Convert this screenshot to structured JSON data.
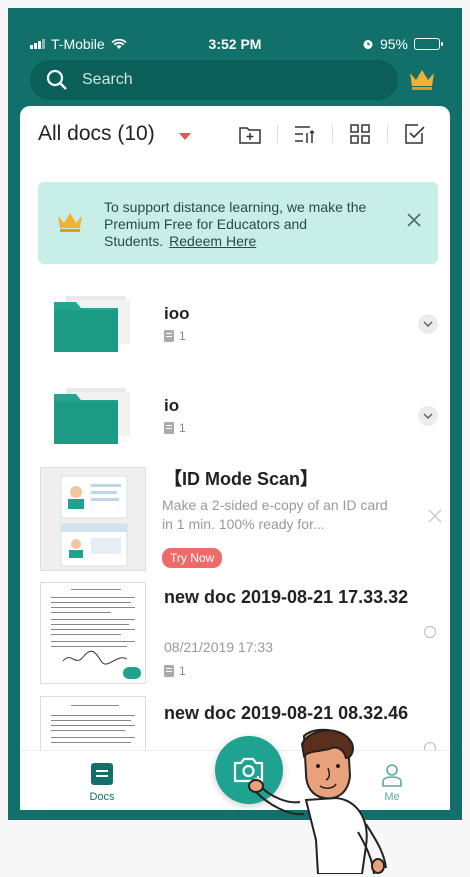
{
  "status": {
    "carrier": "T-Mobile",
    "time": "3:52 PM",
    "battery": "95%"
  },
  "search": {
    "placeholder": "Search"
  },
  "header": {
    "title": "All docs (10)"
  },
  "banner": {
    "text": "To support distance learning, we make the Premium Free for Educators and Students.",
    "link": "Redeem Here"
  },
  "items": [
    {
      "title": "ioo",
      "count": "1",
      "type": "folder"
    },
    {
      "title": "io",
      "count": "1",
      "type": "folder"
    },
    {
      "title": "【ID Mode Scan】",
      "desc": "Make a 2-sided e-copy of an ID card in 1 min. 100% ready for...",
      "badge": "Try Now",
      "type": "promo"
    },
    {
      "title": "new doc 2019-08-21 17.33.32",
      "date": "08/21/2019 17:33",
      "count": "1",
      "type": "doc"
    },
    {
      "title": "new doc 2019-08-21 08.32.46",
      "type": "doc"
    }
  ],
  "tabs": {
    "docs": "Docs",
    "me": "Me"
  },
  "colors": {
    "brand": "#11706a",
    "accent": "#1fa290",
    "banner": "#c8efe7",
    "badge": "#ef6b6b"
  }
}
